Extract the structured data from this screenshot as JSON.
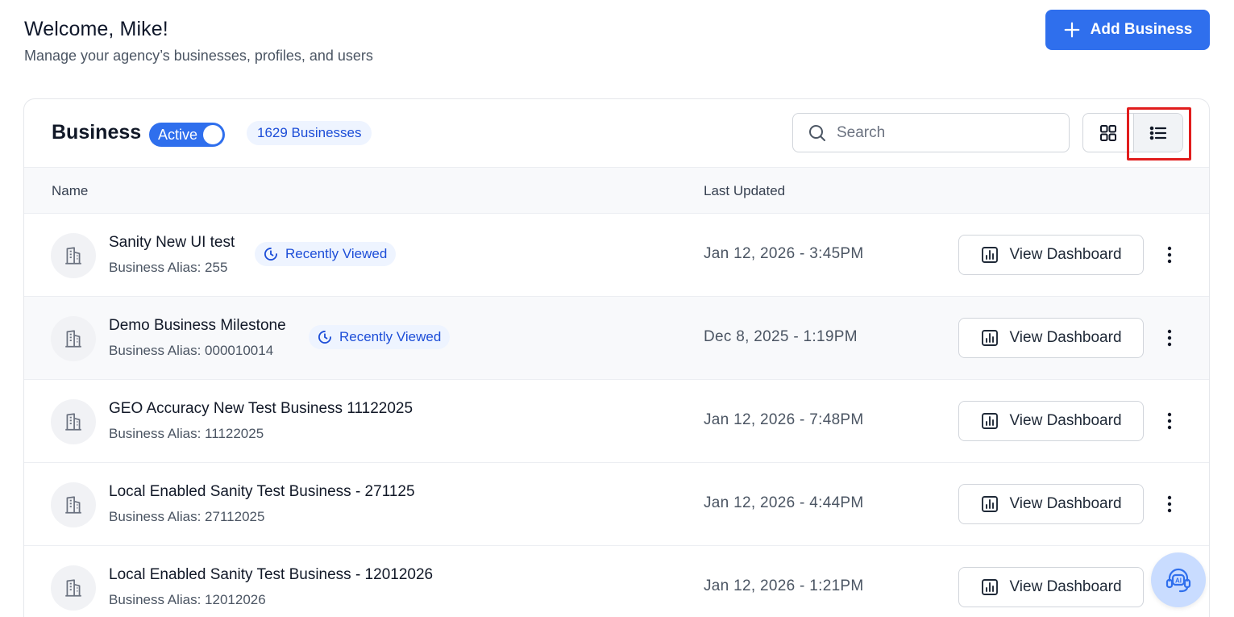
{
  "header": {
    "title": "Welcome, Mike!",
    "subtitle": "Manage your agency’s businesses, profiles, and users",
    "add_button_label": "Add Business"
  },
  "card": {
    "title": "Business",
    "status_toggle": {
      "label": "Active",
      "on": true
    },
    "count_badge": "1629 Businesses",
    "search": {
      "placeholder": "Search",
      "value": ""
    },
    "view_mode": "list",
    "columns": {
      "name": "Name",
      "last_updated": "Last Updated"
    }
  },
  "rows": [
    {
      "name": "Sanity New UI test",
      "alias": "Business Alias: 255",
      "recently_viewed": "Recently Viewed",
      "last_updated": "Jan 12, 2026 - 3:45PM",
      "action": "View Dashboard"
    },
    {
      "name": "Demo Business Milestone",
      "alias": "Business Alias: 000010014",
      "recently_viewed": "Recently Viewed",
      "last_updated": "Dec 8, 2025 - 1:19PM",
      "action": "View Dashboard"
    },
    {
      "name": "GEO Accuracy New Test Business 11122025",
      "alias": "Business Alias: 11122025",
      "recently_viewed": "",
      "last_updated": "Jan 12, 2026 - 7:48PM",
      "action": "View Dashboard"
    },
    {
      "name": "Local Enabled Sanity Test Business - 271125",
      "alias": "Business Alias: 27112025",
      "recently_viewed": "",
      "last_updated": "Jan 12, 2026 - 4:44PM",
      "action": "View Dashboard"
    },
    {
      "name": "Local Enabled Sanity Test Business - 12012026",
      "alias": "Business Alias: 12012026",
      "recently_viewed": "",
      "last_updated": "Jan 12, 2026 - 1:21PM",
      "action": "View Dashboard"
    }
  ],
  "icons": {
    "add": "plus-icon",
    "search": "search-icon",
    "grid_view": "grid-view-icon",
    "list_view": "list-view-icon",
    "business": "building-icon",
    "recent": "clock-icon",
    "dashboard": "bar-chart-icon",
    "more": "kebab-menu-icon",
    "assistant": "ai-assistant-icon"
  },
  "colors": {
    "accent": "#2f6fed",
    "badge_bg": "#eef4ff",
    "badge_text": "#1d4ed8",
    "highlight": "#e11d1d"
  }
}
